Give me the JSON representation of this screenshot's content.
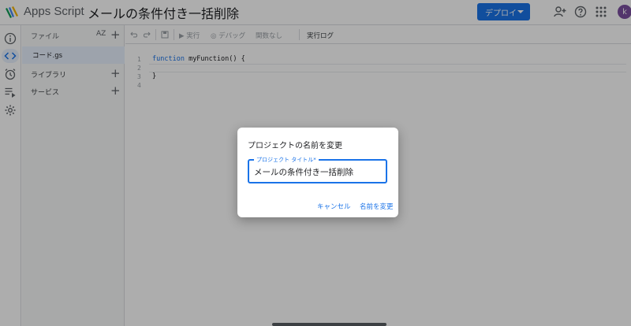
{
  "app": {
    "name": "Apps Script",
    "project_title": "メールの条件付き一括削除"
  },
  "header": {
    "deploy_label": "デプロイ",
    "avatar_initial": "k"
  },
  "files": {
    "title": "ファイル",
    "sort_icon": "AZ",
    "items": [
      {
        "name": "コード.gs"
      }
    ],
    "sections": [
      {
        "label": "ライブラリ"
      },
      {
        "label": "サービス"
      }
    ]
  },
  "toolbar": {
    "run_label": "実行",
    "debug_label": "デバッグ",
    "function_select": "関数なし",
    "exec_log_label": "実行ログ"
  },
  "editor": {
    "line_numbers": [
      "1",
      "2",
      "3",
      "4"
    ],
    "lines": [
      "function myFunction() {",
      "",
      "}",
      ""
    ]
  },
  "dialog": {
    "title": "プロジェクトの名前を変更",
    "field_label": "プロジェクト タイトル*",
    "field_value": "メールの条件付き一括削除",
    "cancel_label": "キャンセル",
    "rename_label": "名前を変更"
  },
  "colors": {
    "accent": "#1a73e8",
    "overlay": "rgba(0,0,0,0.32)"
  }
}
